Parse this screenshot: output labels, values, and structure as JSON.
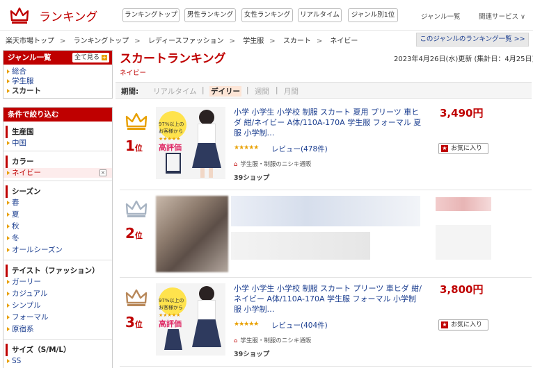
{
  "header": {
    "logo_text": "ランキング",
    "nav_buttons": [
      "ランキングトップ",
      "男性ランキング",
      "女性ランキング",
      "リアルタイム",
      "ジャンル別1位"
    ],
    "genre_list_link": "ジャンル一覧",
    "related_service": "関連サービス ∨"
  },
  "breadcrumb": [
    "楽天市場トップ",
    "ランキングトップ",
    "レディースファッション",
    "学生服",
    "スカート",
    "ネイビー"
  ],
  "genre_ranking_button": "このジャンルのランキング一覧 >>",
  "sidebar": {
    "genre_title": "ジャンル一覧",
    "see_all": "全て見る",
    "genre_items": [
      "総合",
      "学生服",
      "スカート"
    ],
    "filter_title": "条件で絞り込む",
    "groups": [
      {
        "title": "生産国",
        "items": [
          "中国"
        ]
      },
      {
        "title": "カラー",
        "items": [
          "ネイビー"
        ]
      },
      {
        "title": "シーズン",
        "items": [
          "春",
          "夏",
          "秋",
          "冬",
          "オールシーズン"
        ]
      },
      {
        "title": "テイスト（ファッション）",
        "items": [
          "ガーリー",
          "カジュアル",
          "シンプル",
          "フォーマル",
          "原宿系"
        ]
      },
      {
        "title": "サイズ（S/M/L）",
        "items": [
          "SS",
          "S"
        ]
      }
    ]
  },
  "main": {
    "title": "スカートランキング",
    "subtitle": "ネイビー",
    "updated": "2023年4月26日(水)更新 (集計日：4月25日)",
    "period_label": "期間:",
    "periods": [
      "リアルタイム",
      "デイリー",
      "週間",
      "月間"
    ],
    "active_period": "デイリー"
  },
  "items": [
    {
      "rank": "1",
      "rank_suffix": "位",
      "crown_color": "#e8a000",
      "title": "小学 小学生 小学校 制服 スカート 夏用 プリーツ 車ヒダ 紺/ネイビー A体/110A-170A 学生服 フォーマル 夏服 小学制…",
      "stars": "★★★★★",
      "review": "レビュー(478件)",
      "shop": "学生服・制服のニシキ通販",
      "points": "39ショップ",
      "price": "3,490円",
      "fav": "お気に入り",
      "thumb_badge_1": "97%以上の",
      "thumb_badge_2": "お客様から",
      "thumb_badge_3": "高評価"
    },
    {
      "rank": "2",
      "rank_suffix": "位",
      "crown_color": "#a7b3c2"
    },
    {
      "rank": "3",
      "rank_suffix": "位",
      "crown_color": "#b8885a",
      "title": "小学 小学生 小学校 制服 スカート プリーツ 車ヒダ 紺/ネイビー A体/110A-170A 学生服 フォーマル 小学制服 小学制…",
      "stars": "★★★★★",
      "review": "レビュー(404件)",
      "shop": "学生服・制服のニシキ通販",
      "points": "39ショップ",
      "price": "3,800円",
      "fav": "お気に入り",
      "thumb_badge_1": "97%以上の",
      "thumb_badge_2": "お客様から",
      "thumb_badge_3": "高評価"
    }
  ]
}
